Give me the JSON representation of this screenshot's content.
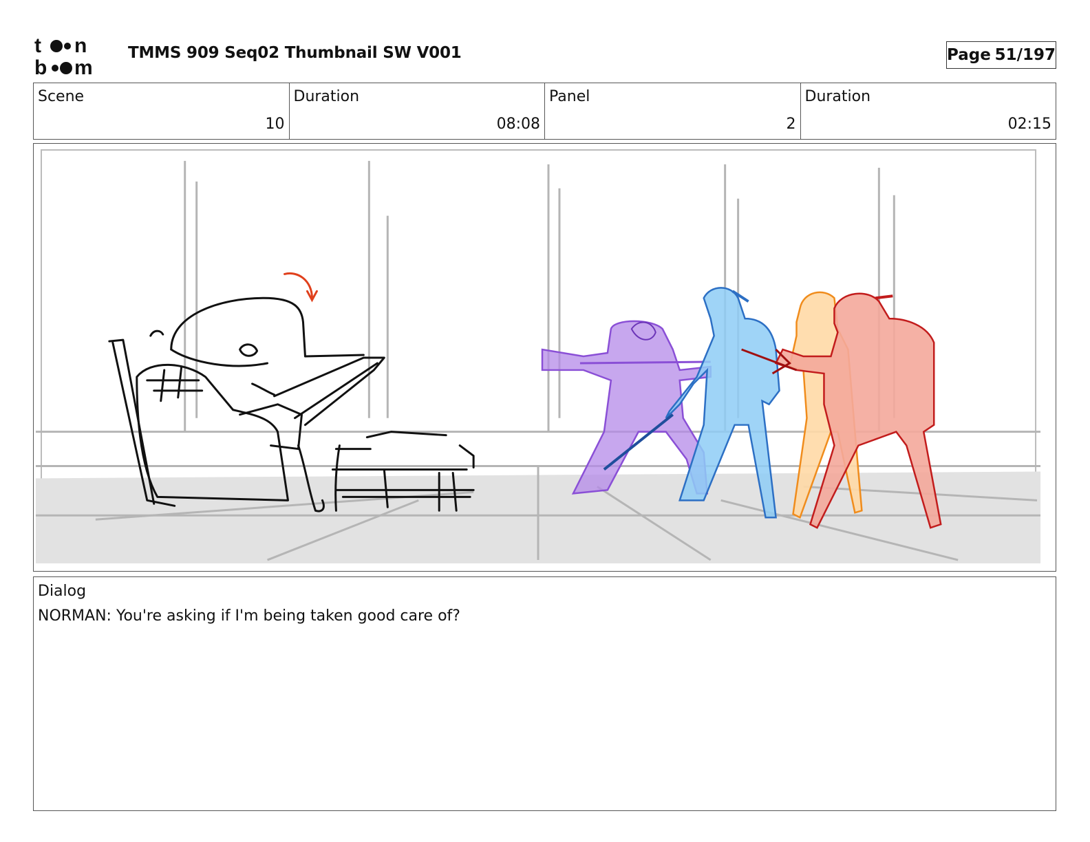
{
  "header": {
    "logo_text_top": "toon",
    "logo_text_bottom": "boom",
    "title": "TMMS 909 Seq02 Thumbnail SW V001",
    "page_label": "Page",
    "page_number": "51/197"
  },
  "info": {
    "scene_label": "Scene",
    "scene_value": "10",
    "scene_duration_label": "Duration",
    "scene_duration_value": "08:08",
    "panel_label": "Panel",
    "panel_value": "2",
    "panel_duration_label": "Duration",
    "panel_duration_value": "02:15"
  },
  "panel": {
    "figure_colors": {
      "sketch": "#111111",
      "arrow": "#e0401c",
      "purple": "#b48ae8",
      "blue": "#8ecdf6",
      "orange": "#ffd9a6",
      "red": "#f4a89b"
    }
  },
  "dialog": {
    "label": "Dialog",
    "text": "NORMAN: You're asking if I'm being taken good care of?"
  }
}
